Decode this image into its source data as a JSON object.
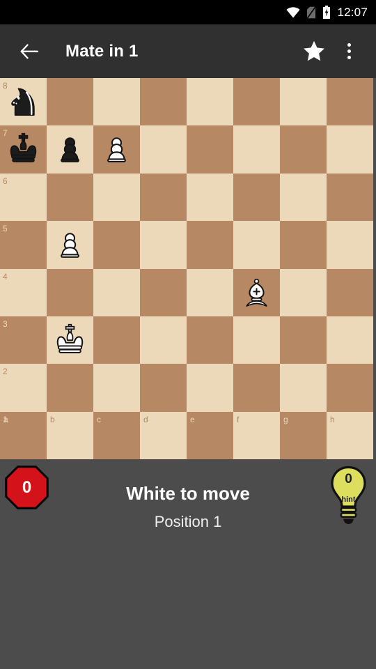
{
  "statusbar": {
    "time": "12:07",
    "icons": [
      "wifi-icon",
      "no-sim-icon",
      "battery-charging-icon"
    ]
  },
  "appbar": {
    "back_label": "back-arrow",
    "title": "Mate in 1",
    "star_label": "favorite",
    "overflow_label": "more options"
  },
  "board": {
    "files": [
      "a",
      "b",
      "c",
      "d",
      "e",
      "f",
      "g",
      "h"
    ],
    "ranks": [
      "8",
      "7",
      "6",
      "5",
      "4",
      "3",
      "2",
      "1"
    ],
    "light_color": "#ecd9b9",
    "dark_color": "#b68863",
    "orientation": "white",
    "pieces": [
      {
        "square": "a8",
        "piece": "black-knight"
      },
      {
        "square": "a7",
        "piece": "black-king"
      },
      {
        "square": "b7",
        "piece": "black-pawn"
      },
      {
        "square": "c7",
        "piece": "white-pawn"
      },
      {
        "square": "b5",
        "piece": "white-pawn"
      },
      {
        "square": "f4",
        "piece": "white-bishop"
      },
      {
        "square": "b3",
        "piece": "white-king"
      }
    ]
  },
  "controls": {
    "stop_count": "0",
    "stop_color": "#d41219",
    "to_move": "White to move",
    "position": "Position 1",
    "hint_count": "0",
    "hint_label": "hint",
    "hint_color": "#dede5e"
  }
}
